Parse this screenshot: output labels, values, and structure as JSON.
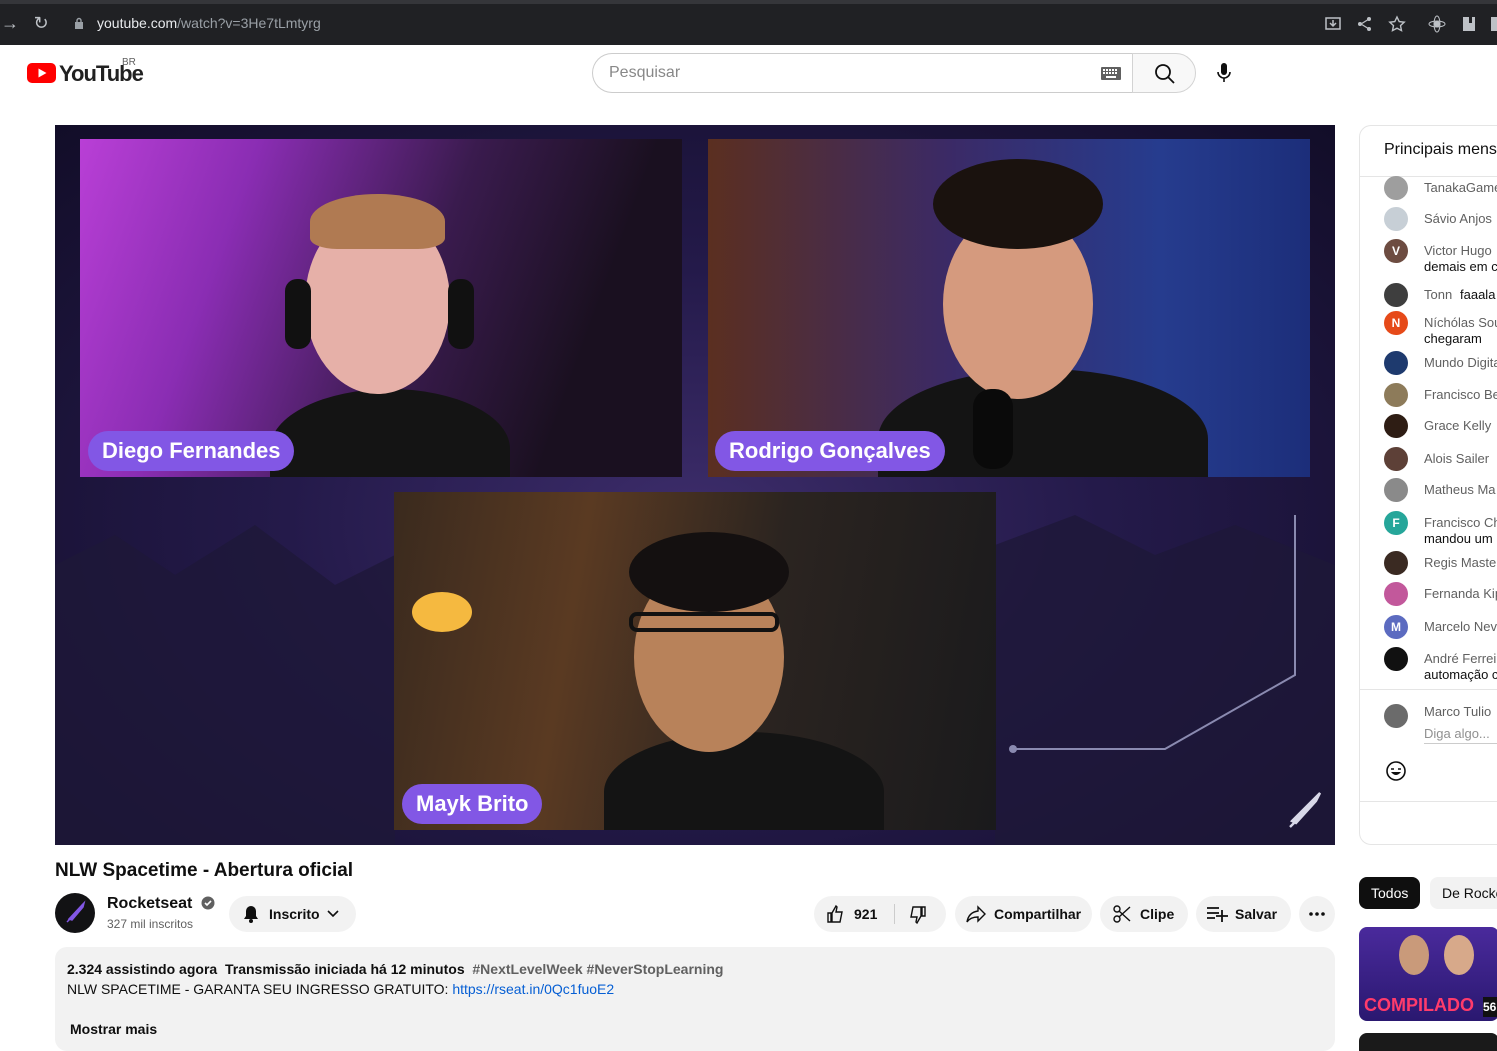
{
  "browser": {
    "url_host": "youtube.com",
    "url_path": "/watch?v=3He7tLmtyrg"
  },
  "header": {
    "logo_text": "YouTube",
    "country": "BR",
    "search_placeholder": "Pesquisar"
  },
  "video": {
    "speakers": [
      "Diego Fernandes",
      "Rodrigo Gonçalves",
      "Mayk Brito"
    ],
    "title": "NLW Spacetime - Abertura oficial"
  },
  "channel": {
    "name": "Rocketseat",
    "subscribers": "327 mil inscritos",
    "subscribed_label": "Inscrito"
  },
  "actions": {
    "likes": "921",
    "share": "Compartilhar",
    "clip": "Clipe",
    "save": "Salvar"
  },
  "description": {
    "watching": "2.324 assistindo agora",
    "started": "Transmissão iniciada há 12 minutos",
    "tags": "#NextLevelWeek #NeverStopLearning",
    "text": "NLW SPACETIME - GARANTA SEU INGRESSO GRATUITO:",
    "link": "https://rseat.in/0Qc1fuoE2",
    "more": "Mostrar mais"
  },
  "chat": {
    "title": "Principais mensagens",
    "messages": [
      {
        "name": "TanakaGamer",
        "text": "",
        "color": "#9e9e9e"
      },
      {
        "name": "Sávio Anjos",
        "text": "",
        "color": "#c7cfd6"
      },
      {
        "name": "Victor Hugo",
        "text": "demais em c",
        "color": "#6d4c41",
        "initial": "V"
      },
      {
        "name": "Tonn",
        "text": "faaala",
        "color": "#3e3e3e"
      },
      {
        "name": "Níchólas Sou",
        "text": "chegaram",
        "color": "#e64a19",
        "initial": "N"
      },
      {
        "name": "Mundo Digital",
        "text": "",
        "color": "#1e3a6e"
      },
      {
        "name": "Francisco Be",
        "text": "",
        "color": "#8d7b5a"
      },
      {
        "name": "Grace Kelly",
        "text": "",
        "color": "#2e1d14"
      },
      {
        "name": "Alois Sailer",
        "text": "",
        "color": "#5d4037"
      },
      {
        "name": "Matheus Ma",
        "text": "",
        "color": "#8a8a8a"
      },
      {
        "name": "Francisco Ch",
        "text": "mandou um",
        "color": "#26a69a",
        "initial": "F"
      },
      {
        "name": "Regis Maste",
        "text": "",
        "color": "#3a2a22"
      },
      {
        "name": "Fernanda Kip",
        "text": "",
        "color": "#c2589b"
      },
      {
        "name": "Marcelo Nev",
        "text": "",
        "color": "#5c6bc0",
        "initial": "M"
      },
      {
        "name": "André Ferreir",
        "text": "automação c",
        "color": "#111111"
      }
    ],
    "current_user": "Marco Tulio",
    "input_placeholder": "Diga algo..."
  },
  "sidebar": {
    "chips": [
      "Todos",
      "De Rocke"
    ],
    "thumb_text": "COMPILADO",
    "thumb_badge": "56"
  },
  "colors": {
    "brand_red": "#ff0000",
    "name_tag": "#8257e5",
    "link": "#065fd4"
  }
}
